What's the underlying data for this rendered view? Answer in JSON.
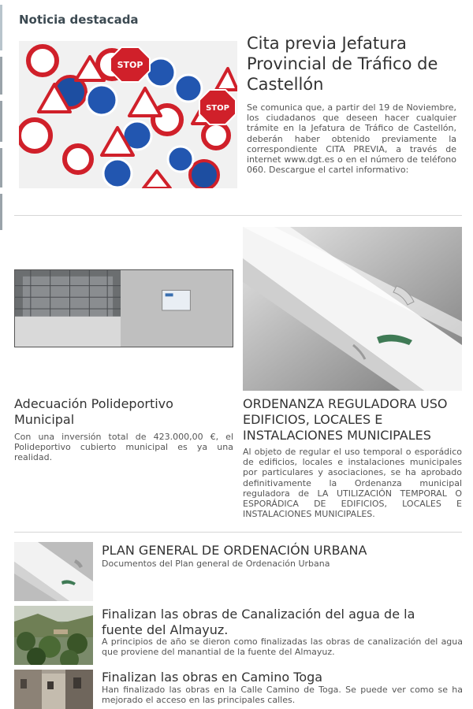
{
  "section": {
    "title": "Noticia destacada"
  },
  "featured": {
    "title": "Cita previa Jefatura Provincial de Tráfico de Castellón",
    "body": "Se comunica que, a partir del 19 de Noviembre, los ciudadanos que deseen hacer cualquier trámite en la Jefatura de Tráfico de Castellón, deberán haber obtenido previamente la correspondiente CITA PREVIA, a través de internet www.dgt.es o en el número de teléfono 060. Descargue el cartel informativo:",
    "image_label": "STOP"
  },
  "card_left": {
    "title": "Adecuación Polideportivo Municipal",
    "body": "Con una inversión total de 423.000,00 €, el Polideportivo cubierto municipal es ya una realidad."
  },
  "card_right": {
    "title": "ORDENANZA REGULADORA USO EDIFICIOS, LOCALES E INSTALACIONES MUNICIPALES",
    "body": "Al objeto de regular el uso temporal o esporádico de edificios, locales e instalaciones municipales por particulares y asociaciones, se ha aprobado definitivamente la Ordenanza municipal reguladora de LA UTILIZACIÓN TEMPORAL O ESPORÁDICA DE EDIFICIOS, LOCALES E INSTALACIONES MUNICIPALES."
  },
  "list": [
    {
      "title": "PLAN GENERAL DE ORDENACIÓN URBANA",
      "body": "Documentos del Plan general de Ordenación Urbana"
    },
    {
      "title": "Finalizan las obras de Canalización del agua de la fuente del Almayuz.",
      "body": "A principios de año se dieron como finalizadas las obras de canalización del agua que proviene del manantial de la fuente del Almayuz."
    },
    {
      "title": "Finalizan las obras en Camino Toga",
      "body": "Han finalizado las obras en la Calle Camino de Toga. Se puede ver como se ha mejorado el acceso en las principales calles."
    }
  ]
}
